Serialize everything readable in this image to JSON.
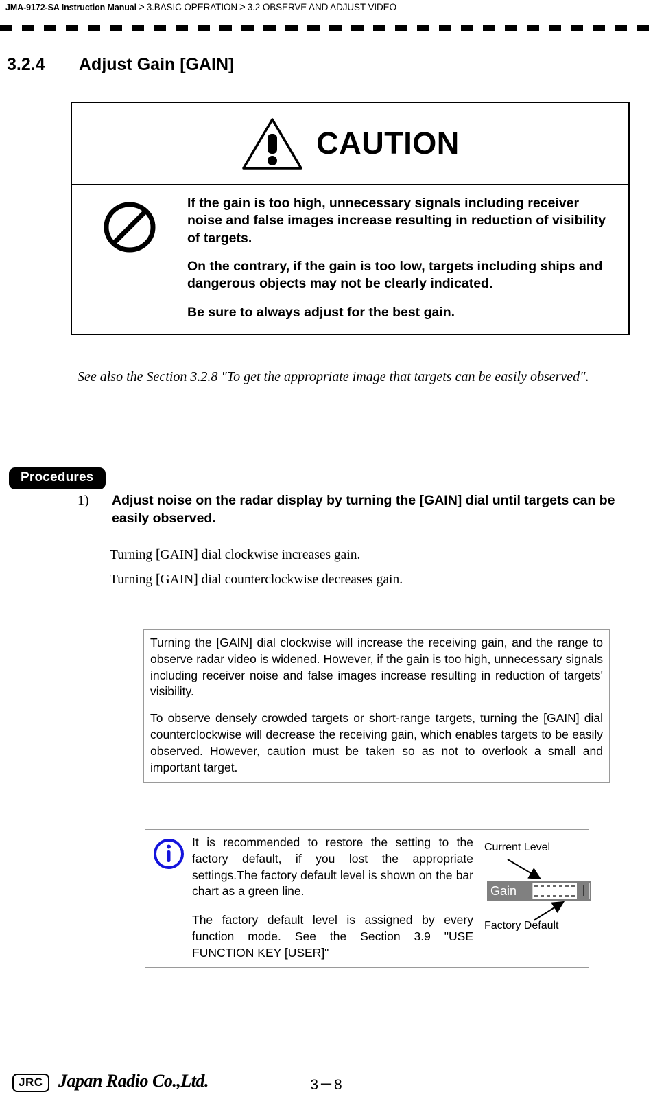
{
  "header": {
    "manual": "JMA-9172-SA Instruction Manual",
    "separator": ">",
    "crumb1": "3.BASIC OPERATION",
    "crumb2": "3.2  OBSERVE AND ADJUST VIDEO"
  },
  "section": {
    "number": "3.2.4",
    "title": "Adjust Gain [GAIN]"
  },
  "caution": {
    "heading": "CAUTION",
    "icon_warning": "warning-triangle-icon",
    "icon_prohibition": "prohibition-icon",
    "paragraphs": [
      "If the gain is too high, unnecessary signals including receiver noise and false images increase resulting in reduction of visibility of targets.",
      "On the contrary, if the gain is too low, targets including ships and dangerous objects may not be clearly indicated.",
      "Be sure to always adjust for the best gain."
    ]
  },
  "see_also": "See also the Section 3.2.8 \"To get the appropriate image that targets can be easily observed\".",
  "procedures": {
    "badge": "Procedures",
    "step_number": "1)",
    "step_text": "Adjust noise on the radar display by turning the [GAIN] dial until targets can be easily observed.",
    "body_lines": [
      "Turning [GAIN] dial clockwise increases gain.",
      "Turning [GAIN] dial counterclockwise decreases gain."
    ]
  },
  "note_box": {
    "paragraphs": [
      "Turning the [GAIN] dial clockwise will increase the receiving gain, and the range to observe radar video is widened. However, if the gain is too high, unnecessary signals including receiver noise and false images increase resulting in reduction of targets' visibility.",
      "To observe densely crowded targets or short-range targets, turning the [GAIN] dial counterclockwise will decrease the receiving gain, which enables targets to be easily observed. However, caution must be taken so as not to overlook a small and important target."
    ]
  },
  "info_box": {
    "icon": "info-circle-icon",
    "icon_color": "#1414dc",
    "paragraphs": [
      "It is recommended to restore the setting to the factory default, if you lost the appropriate settings.The factory default level is shown on the bar chart as a green line.",
      "The factory default level is assigned by every function mode. See the Section 3.9 \"USE FUNCTION KEY [USER]\""
    ],
    "figure": {
      "current_level_label": "Current Level",
      "factory_default_label": "Factory Default",
      "gain_label": "Gain",
      "bar_background": "#808080",
      "bar_fill": "#ffffff"
    }
  },
  "footer": {
    "logo_mark": "JRC",
    "company": "Japan Radio Co.,Ltd.",
    "page_number": "3－8"
  }
}
